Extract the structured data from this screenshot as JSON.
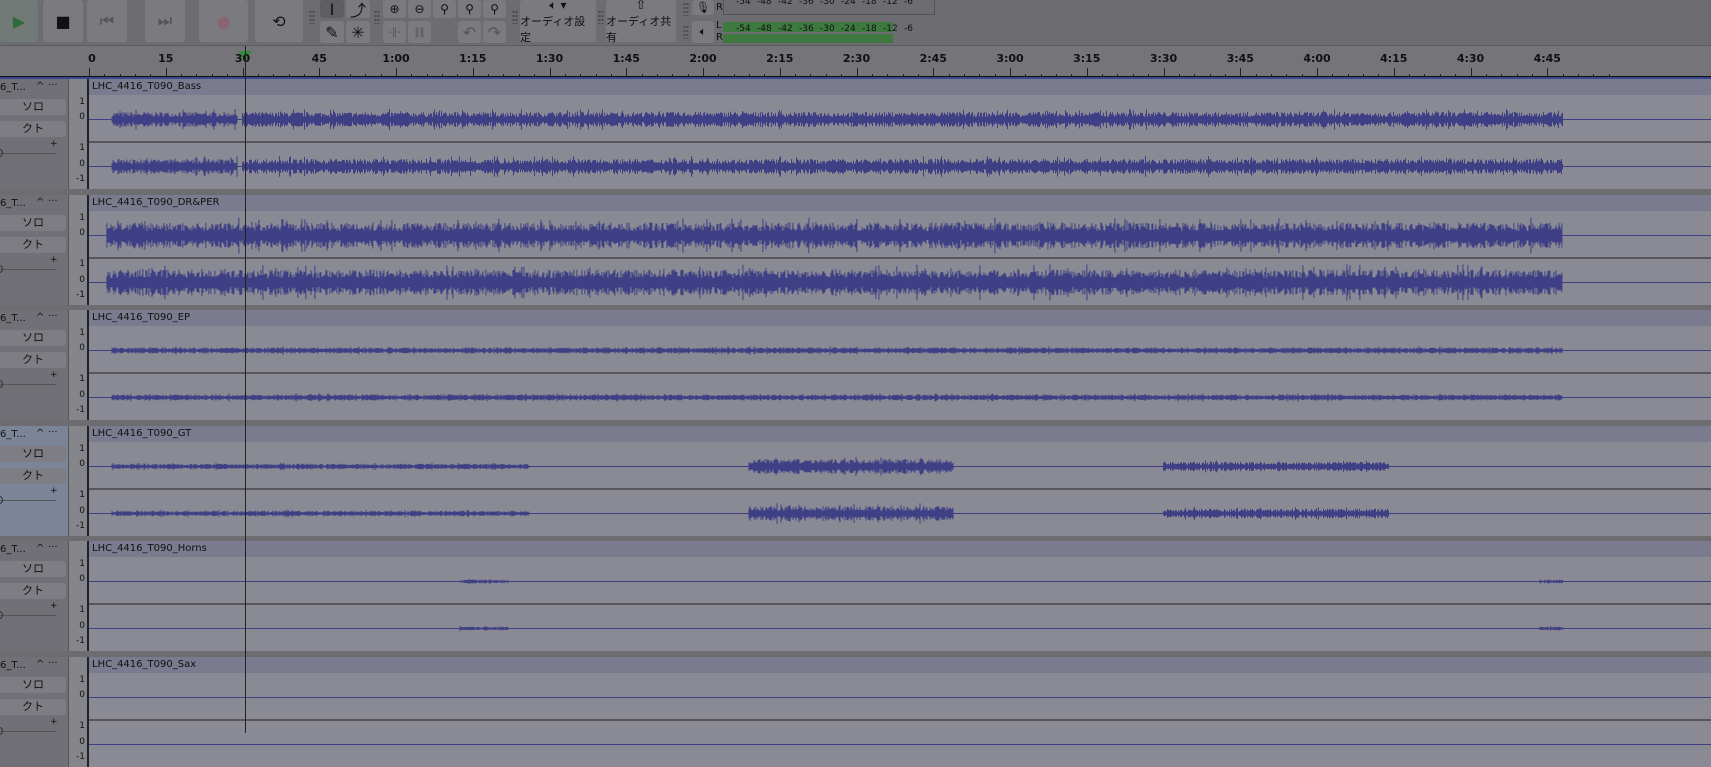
{
  "toolbar": {
    "transport": [
      {
        "name": "play-button",
        "icon": "play-icon"
      },
      {
        "name": "stop-button",
        "icon": "stop-icon"
      },
      {
        "name": "skip-start-button",
        "icon": "skip-start-icon"
      },
      {
        "name": "skip-end-button",
        "icon": "skip-end-icon"
      },
      {
        "name": "record-button",
        "icon": "record-icon"
      },
      {
        "name": "loop-button",
        "icon": "loop-icon"
      }
    ],
    "audio_settings_label": "オーディオ設定",
    "share_label": "オーディオ共有",
    "meter_ticks": [
      "-54",
      "-48",
      "-42",
      "-36",
      "-30",
      "-24",
      "-18",
      "-12",
      "-6"
    ],
    "rec_meter_channel": "R",
    "play_meter_l": "L",
    "play_meter_r": "R"
  },
  "ruler": {
    "labels": [
      "0",
      "15",
      "30",
      "45",
      "1:00",
      "1:15",
      "1:30",
      "1:45",
      "2:00",
      "2:15",
      "2:30",
      "2:45",
      "3:00",
      "3:15",
      "3:30",
      "3:45",
      "4:00",
      "4:15",
      "4:30",
      "4:45"
    ],
    "playhead_seconds": 30.5
  },
  "track_header": {
    "name": "6_T...",
    "solo": "ソロ",
    "mute": "クト",
    "collapse": "^",
    "menu": "···",
    "gain_plus": "+"
  },
  "scale": {
    "one": "1",
    "zero": "0",
    "neg": "-1"
  },
  "colors": {
    "wave": "#3e3f85",
    "accent": "#3b4690"
  },
  "tracks": [
    {
      "clip": "LHC_4416_T090_Bass",
      "segments": [
        [
          4.5,
          29,
          0.35
        ],
        [
          30,
          288,
          0.35
        ]
      ]
    },
    {
      "clip": "LHC_4416_T090_DR&PER",
      "segments": [
        [
          3.5,
          288,
          0.6
        ]
      ]
    },
    {
      "clip": "LHC_4416_T090_EP",
      "segments": [
        [
          4.5,
          288,
          0.14
        ]
      ]
    },
    {
      "clip": "LHC_4416_T090_GT",
      "selected": true,
      "segments": [
        [
          4.5,
          86,
          0.13
        ],
        [
          129,
          169,
          0.35
        ],
        [
          210,
          254,
          0.22
        ]
      ]
    },
    {
      "clip": "LHC_4416_T090_Horns",
      "segments": [
        [
          72.5,
          82,
          0.09
        ],
        [
          283.5,
          288,
          0.09
        ]
      ]
    },
    {
      "clip": "LHC_4416_T090_Sax",
      "segments": []
    }
  ]
}
